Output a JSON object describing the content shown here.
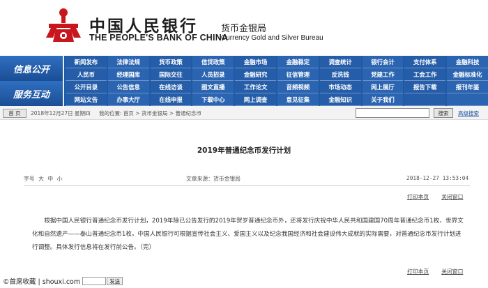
{
  "header": {
    "bank_name_cn": "中国人民银行",
    "bank_name_en": "THE PEOPLE'S BANK OF CHINA",
    "dept_cn": "货币金银局",
    "dept_en": "Currency Gold and Silver Bureau",
    "emblem_color": "#c8161d"
  },
  "nav": {
    "label_info": "信息公开",
    "label_service": "服务互动",
    "rows": [
      [
        "新闻发布",
        "法律法规",
        "货币政策",
        "信贷政策",
        "金融市场",
        "金融稳定",
        "调查统计",
        "银行会计",
        "支付体系",
        "金融科技"
      ],
      [
        "人民币",
        "经理国库",
        "国际交往",
        "人员招录",
        "金融研究",
        "征信管理",
        "反洗钱",
        "党建工作",
        "工会工作",
        "金融标准化"
      ],
      [
        "公开目录",
        "公告信息",
        "在线访谈",
        "图文直播",
        "工作论文",
        "音频视频",
        "市场动态",
        "网上展厅",
        "报告下载",
        "报刊年鉴"
      ],
      [
        "网站文告",
        "办事大厅",
        "在线申报",
        "下载中心",
        "网上调查",
        "意见征集",
        "金融知识",
        "关于我们",
        "",
        ""
      ]
    ]
  },
  "infobar": {
    "home": "首 页",
    "date": "2018年12月27日  星期四",
    "crumbs": "我的位置: 首页 > 货币金银局 > 普通纪念币",
    "search_button": "搜索",
    "advanced_search": "高级搜索"
  },
  "article": {
    "title": "2019年普通纪念币发行计划",
    "font_label": "字号",
    "font_large": "大",
    "font_medium": "中",
    "font_small": "小",
    "source": "文章来源：货币金银局",
    "timestamp": "2018-12-27  13:53:04",
    "print_label": "打印本页",
    "close_label": "关闭窗口",
    "body": "根据中国人民银行普通纪念币发行计划，2019年除已公告发行的2019年贺岁普通纪念币外，还将发行庆祝中华人民共和国建国70周年普通纪念币1枚、世界文化和自然遗产——泰山普通纪念币1枚。中国人民银行可根据宣传社会主义、爱国主义以及纪念我国经济和社会建设伟大成就的实际需要，对普通纪念币发行计划进行调整。具体发行信息将在发行前公告。（完）"
  },
  "watermark": {
    "text": "©首席收藏 | shouxi.com",
    "button": "发送"
  }
}
